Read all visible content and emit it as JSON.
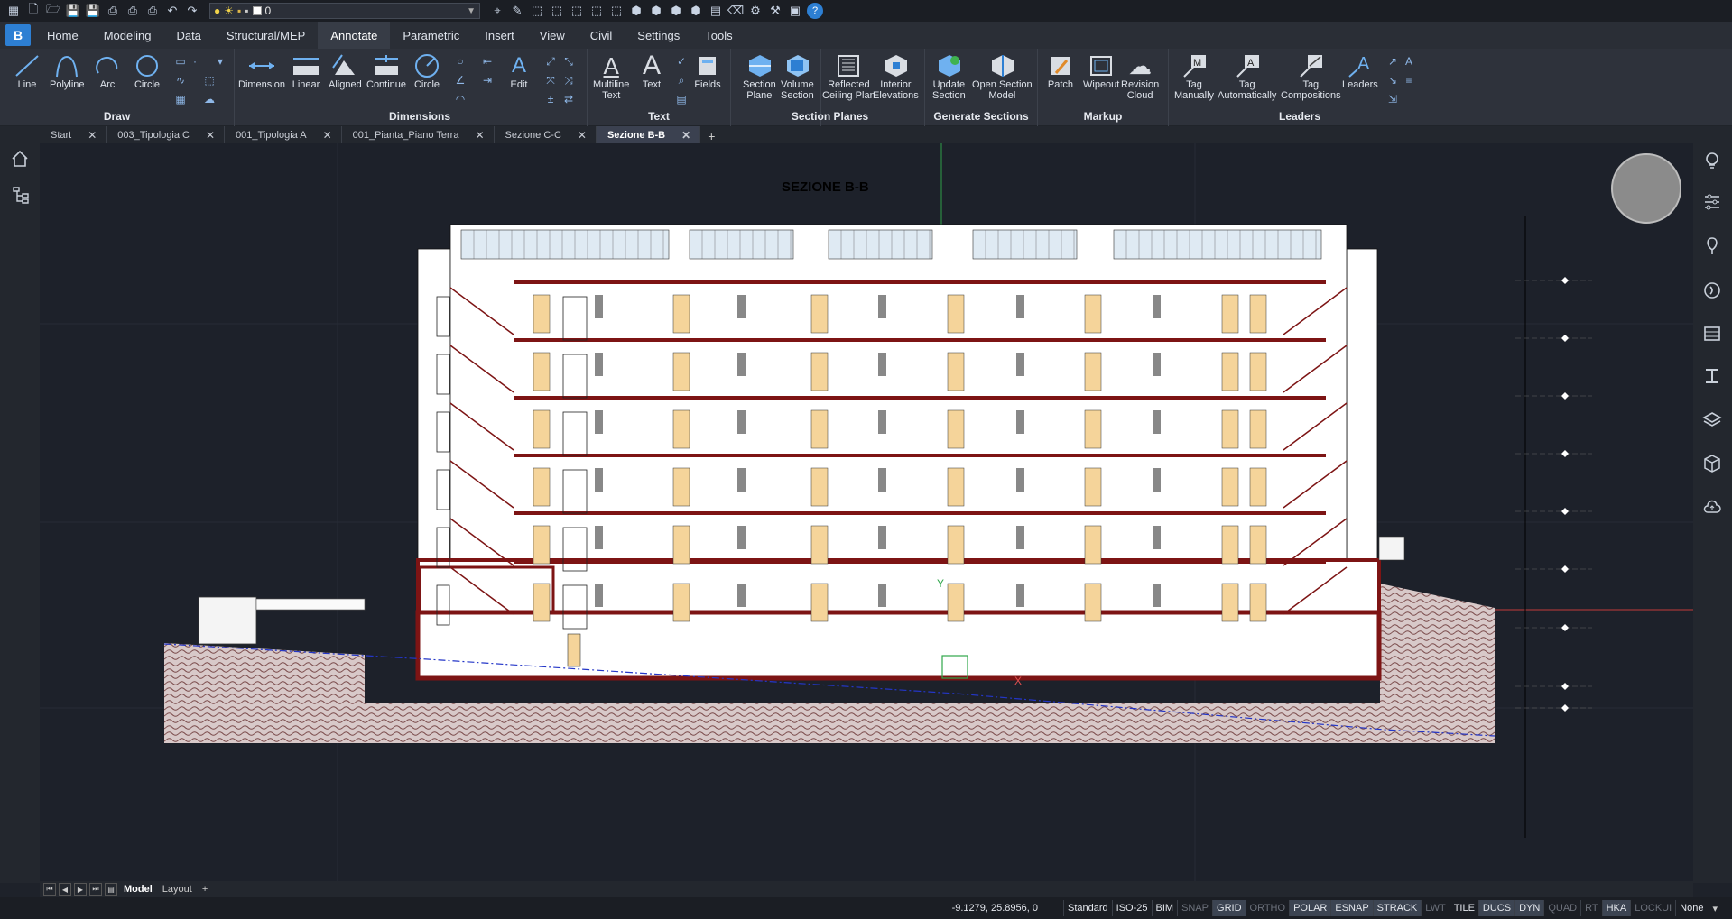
{
  "layer": {
    "name": "0"
  },
  "menus": [
    "Home",
    "Modeling",
    "Data",
    "Structural/MEP",
    "Annotate",
    "Parametric",
    "Insert",
    "View",
    "Civil",
    "Settings",
    "Tools"
  ],
  "active_menu": "Annotate",
  "ribbon": {
    "draw": {
      "title": "Draw",
      "line": "Line",
      "polyline": "Polyline",
      "arc": "Arc",
      "circle": "Circle"
    },
    "dimensions": {
      "title": "Dimensions",
      "dimension": "Dimension",
      "linear": "Linear",
      "aligned": "Aligned",
      "continue": "Continue",
      "circle": "Circle",
      "edit": "Edit"
    },
    "text": {
      "title": "Text",
      "multiline1": "Multiline",
      "multiline2": "Text",
      "text": "Text",
      "fields": "Fields"
    },
    "section_planes": {
      "title": "Section Planes",
      "section1": "Section",
      "section2": "Plane",
      "volume1": "Volume",
      "volume2": "Section",
      "reflected1": "Reflected",
      "reflected2": "Ceiling Plan",
      "interior1": "Interior",
      "interior2": "Elevations"
    },
    "generate_sections": {
      "title": "Generate Sections",
      "update1": "Update",
      "update2": "Section",
      "open1": "Open Section",
      "open2": "Model"
    },
    "markup": {
      "title": "Markup",
      "patch": "Patch",
      "wipeout": "Wipeout",
      "revision1": "Revision",
      "revision2": "Cloud"
    },
    "leaders": {
      "title": "Leaders",
      "tagm1": "Tag",
      "tagm2": "Manually",
      "taga1": "Tag",
      "taga2": "Automatically",
      "tagc1": "Tag",
      "tagc2": "Compositions",
      "leaders": "Leaders"
    }
  },
  "tabs": [
    "Start",
    "003_Tipologia C",
    "001_Tipologia A",
    "001_Pianta_Piano Terra",
    "Sezione C-C",
    "Sezione B-B"
  ],
  "active_tab": "Sezione B-B",
  "drawing": {
    "title": "SEZIONE  B-B",
    "ucs_y": "Y",
    "ucs_x": "X"
  },
  "layout_tabs": {
    "model": "Model",
    "layout": "Layout",
    "add": "+"
  },
  "status": {
    "coords": "-9.1279, 25.8956, 0",
    "items": [
      {
        "label": "Standard",
        "state": "normal"
      },
      {
        "label": "ISO-25",
        "state": "normal"
      },
      {
        "label": "BIM",
        "state": "normal"
      },
      {
        "label": "SNAP",
        "state": "off"
      },
      {
        "label": "GRID",
        "state": "on"
      },
      {
        "label": "ORTHO",
        "state": "off"
      },
      {
        "label": "POLAR",
        "state": "on"
      },
      {
        "label": "ESNAP",
        "state": "on"
      },
      {
        "label": "STRACK",
        "state": "on"
      },
      {
        "label": "LWT",
        "state": "off"
      },
      {
        "label": "TILE",
        "state": "normal"
      },
      {
        "label": "DUCS",
        "state": "on"
      },
      {
        "label": "DYN",
        "state": "on"
      },
      {
        "label": "QUAD",
        "state": "off"
      },
      {
        "label": "RT",
        "state": "off"
      },
      {
        "label": "HKA",
        "state": "on"
      },
      {
        "label": "LOCKUI",
        "state": "off"
      },
      {
        "label": "None",
        "state": "normal"
      }
    ]
  }
}
